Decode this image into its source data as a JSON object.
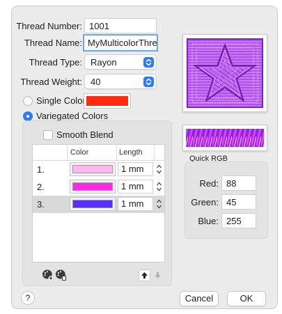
{
  "form": {
    "thread_number_label": "Thread Number:",
    "thread_number_value": "1001",
    "thread_name_label": "Thread Name:",
    "thread_name_value": "MyMulticolorThread",
    "thread_type_label": "Thread Type:",
    "thread_type_value": "Rayon",
    "thread_weight_label": "Thread Weight:",
    "thread_weight_value": "40",
    "single_color_label": "Single Color:",
    "single_color_swatch": "#ff2a10",
    "variegated_label": "Variegated Colors"
  },
  "variegated": {
    "smooth_blend_label": "Smooth Blend",
    "columns": [
      "Color",
      "Length"
    ],
    "rows": [
      {
        "num": "1.",
        "color": "#ffb8ee",
        "length": "1 mm"
      },
      {
        "num": "2.",
        "color": "#ff28e6",
        "length": "1 mm"
      },
      {
        "num": "3.",
        "color": "#5a2dff",
        "length": "1 mm"
      }
    ],
    "selected_row": 2,
    "stepper_glyph": "⌃⌄"
  },
  "quick_rgb": {
    "title": "Quick RGB",
    "red_label": "Red:",
    "red_value": "88",
    "green_label": "Green:",
    "green_value": "45",
    "blue_label": "Blue:",
    "blue_value": "255"
  },
  "buttons": {
    "help": "?",
    "cancel": "Cancel",
    "ok": "OK"
  },
  "colors": {
    "accent": "#2f7bf5",
    "preview_thread": "#b14cf0",
    "preview_thread_dark": "#7a1fc9"
  },
  "icons": {
    "add_color": "palette-add-icon",
    "remove_color": "palette-remove-icon",
    "move_up": "arrow-up-icon",
    "move_down": "arrow-down-icon"
  }
}
